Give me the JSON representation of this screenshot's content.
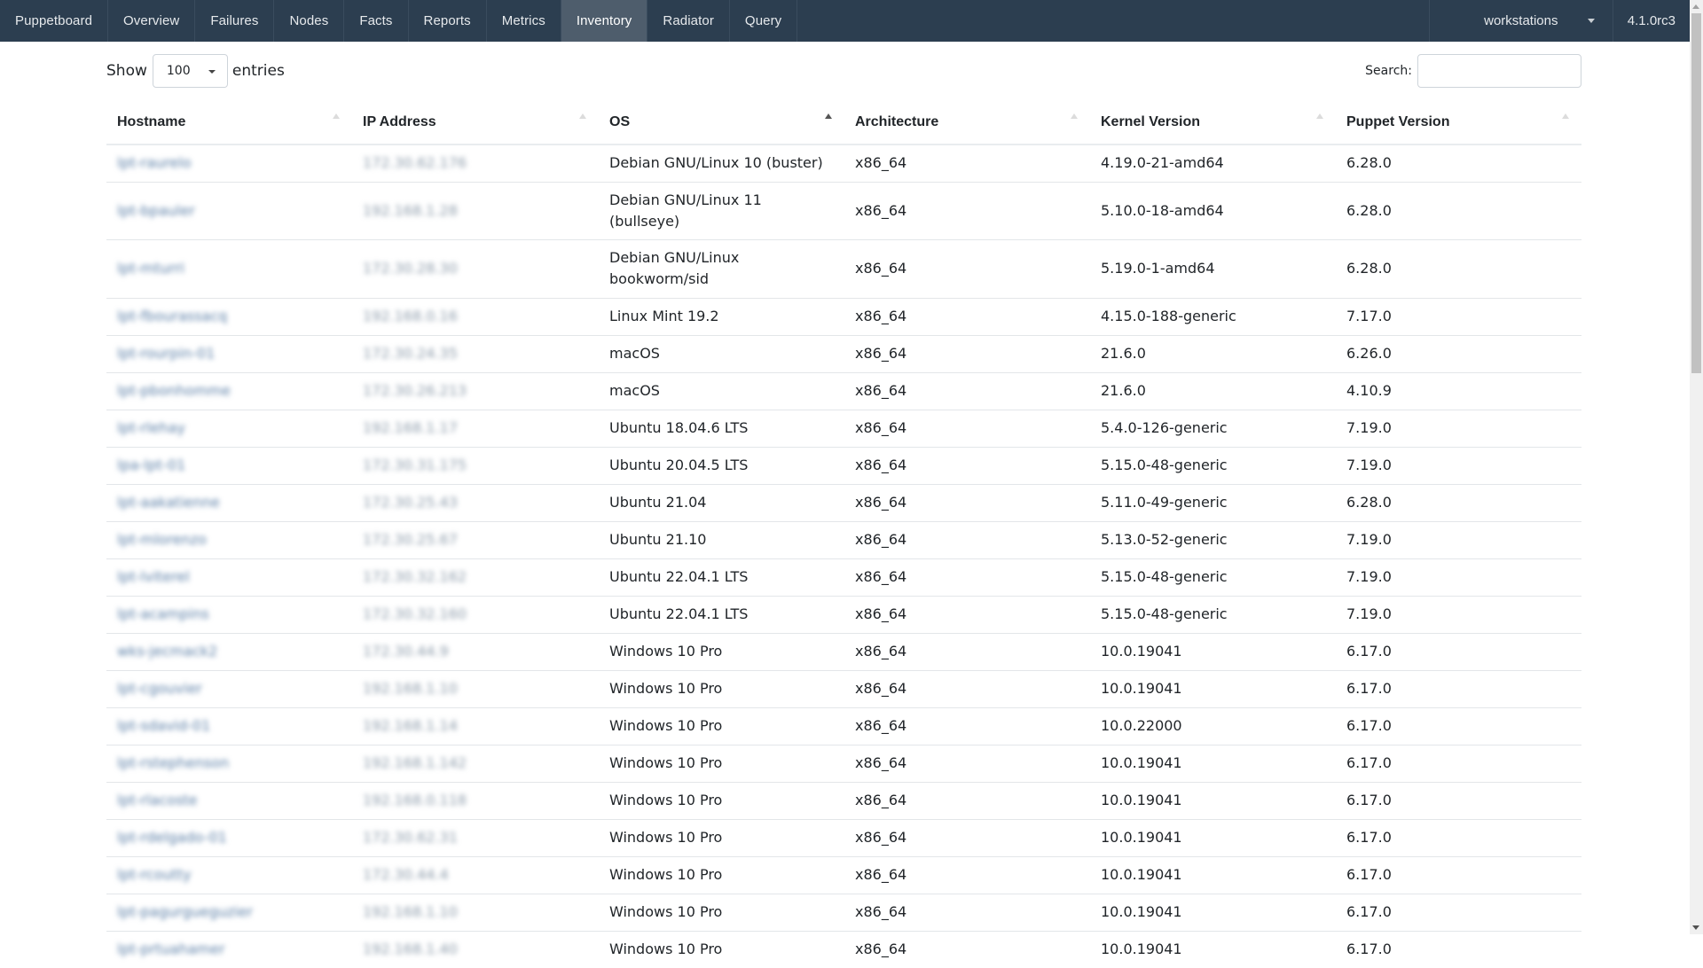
{
  "nav": {
    "brand": "Puppetboard",
    "items": [
      "Overview",
      "Failures",
      "Nodes",
      "Facts",
      "Reports",
      "Metrics",
      "Inventory",
      "Radiator",
      "Query"
    ],
    "active": "Inventory",
    "environment": "workstations",
    "version": "4.1.0rc3"
  },
  "controls": {
    "show_label": "Show",
    "page_length": "100",
    "entries_label": "entries",
    "search_label": "Search:",
    "search_value": ""
  },
  "table": {
    "columns": [
      "Hostname",
      "IP Address",
      "OS",
      "Architecture",
      "Kernel Version",
      "Puppet Version"
    ],
    "sorted_column": "OS",
    "sort_direction": "ascending",
    "rows": [
      {
        "hostname": "lpt-raurelo",
        "ip": "172.30.62.176",
        "os": "Debian GNU/Linux 10 (buster)",
        "arch": "x86_64",
        "kernel": "4.19.0-21-amd64",
        "puppet": "6.28.0"
      },
      {
        "hostname": "lpt-bpauler",
        "ip": "192.168.1.28",
        "os": "Debian GNU/Linux 11 (bullseye)",
        "arch": "x86_64",
        "kernel": "5.10.0-18-amd64",
        "puppet": "6.28.0"
      },
      {
        "hostname": "lpt-mturri",
        "ip": "172.30.28.30",
        "os": "Debian GNU/Linux bookworm/sid",
        "arch": "x86_64",
        "kernel": "5.19.0-1-amd64",
        "puppet": "6.28.0"
      },
      {
        "hostname": "lpt-fbourassacq",
        "ip": "192.168.0.16",
        "os": "Linux Mint 19.2",
        "arch": "x86_64",
        "kernel": "4.15.0-188-generic",
        "puppet": "7.17.0"
      },
      {
        "hostname": "lpt-rourpin-01",
        "ip": "172.30.24.35",
        "os": "macOS",
        "arch": "x86_64",
        "kernel": "21.6.0",
        "puppet": "6.26.0"
      },
      {
        "hostname": "lpt-pbonhomme",
        "ip": "172.30.26.213",
        "os": "macOS",
        "arch": "x86_64",
        "kernel": "21.6.0",
        "puppet": "4.10.9"
      },
      {
        "hostname": "lpt-rlehay",
        "ip": "192.168.1.17",
        "os": "Ubuntu 18.04.6 LTS",
        "arch": "x86_64",
        "kernel": "5.4.0-126-generic",
        "puppet": "7.19.0"
      },
      {
        "hostname": "lpa-lpt-01",
        "ip": "172.30.31.175",
        "os": "Ubuntu 20.04.5 LTS",
        "arch": "x86_64",
        "kernel": "5.15.0-48-generic",
        "puppet": "7.19.0"
      },
      {
        "hostname": "lpt-aakatienne",
        "ip": "172.30.25.43",
        "os": "Ubuntu 21.04",
        "arch": "x86_64",
        "kernel": "5.11.0-49-generic",
        "puppet": "6.28.0"
      },
      {
        "hostname": "lpt-mlorenzo",
        "ip": "172.30.25.67",
        "os": "Ubuntu 21.10",
        "arch": "x86_64",
        "kernel": "5.13.0-52-generic",
        "puppet": "7.19.0"
      },
      {
        "hostname": "lpt-lviterel",
        "ip": "172.30.32.162",
        "os": "Ubuntu 22.04.1 LTS",
        "arch": "x86_64",
        "kernel": "5.15.0-48-generic",
        "puppet": "7.19.0"
      },
      {
        "hostname": "lpt-acampins",
        "ip": "172.30.32.160",
        "os": "Ubuntu 22.04.1 LTS",
        "arch": "x86_64",
        "kernel": "5.15.0-48-generic",
        "puppet": "7.19.0"
      },
      {
        "hostname": "wks-jecmack2",
        "ip": "172.30.44.9",
        "os": "Windows 10 Pro",
        "arch": "x86_64",
        "kernel": "10.0.19041",
        "puppet": "6.17.0"
      },
      {
        "hostname": "lpt-cgouvier",
        "ip": "192.168.1.10",
        "os": "Windows 10 Pro",
        "arch": "x86_64",
        "kernel": "10.0.19041",
        "puppet": "6.17.0"
      },
      {
        "hostname": "lpt-sdavid-01",
        "ip": "192.168.1.14",
        "os": "Windows 10 Pro",
        "arch": "x86_64",
        "kernel": "10.0.22000",
        "puppet": "6.17.0"
      },
      {
        "hostname": "lpt-rstephenson",
        "ip": "192.168.1.142",
        "os": "Windows 10 Pro",
        "arch": "x86_64",
        "kernel": "10.0.19041",
        "puppet": "6.17.0"
      },
      {
        "hostname": "lpt-rlacoste",
        "ip": "192.168.0.118",
        "os": "Windows 10 Pro",
        "arch": "x86_64",
        "kernel": "10.0.19041",
        "puppet": "6.17.0"
      },
      {
        "hostname": "lpt-rdelgado-01",
        "ip": "172.30.62.31",
        "os": "Windows 10 Pro",
        "arch": "x86_64",
        "kernel": "10.0.19041",
        "puppet": "6.17.0"
      },
      {
        "hostname": "lpt-rcoutty",
        "ip": "172.30.44.4",
        "os": "Windows 10 Pro",
        "arch": "x86_64",
        "kernel": "10.0.19041",
        "puppet": "6.17.0"
      },
      {
        "hostname": "lpt-pagurgueguzier",
        "ip": "192.168.1.10",
        "os": "Windows 10 Pro",
        "arch": "x86_64",
        "kernel": "10.0.19041",
        "puppet": "6.17.0"
      },
      {
        "hostname": "lpt-prtuahamer",
        "ip": "192.168.1.40",
        "os": "Windows 10 Pro",
        "arch": "x86_64",
        "kernel": "10.0.19041",
        "puppet": "6.17.0"
      }
    ]
  },
  "colors": {
    "navbar": "#2c3e50",
    "nav_active": "#4e5d6c",
    "link": "#2c6cb0"
  }
}
